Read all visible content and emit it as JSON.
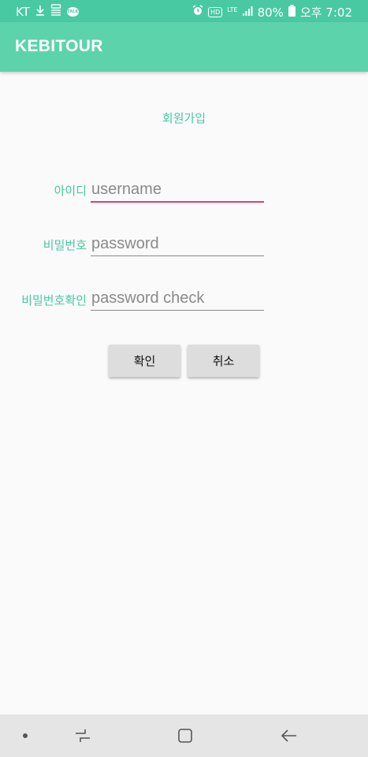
{
  "status_bar": {
    "carrier": "KT",
    "talk_badge": "TALK",
    "hd_badge": "HD",
    "network": "LTE",
    "battery": "80%",
    "time": "오후 7:02"
  },
  "app_bar": {
    "title": "KEBITOUR"
  },
  "page": {
    "heading": "회원가입"
  },
  "form": {
    "username": {
      "label": "아이디",
      "placeholder": "username"
    },
    "password": {
      "label": "비밀번호",
      "placeholder": "password"
    },
    "password_check": {
      "label": "비밀번호확인",
      "placeholder": "password check"
    }
  },
  "buttons": {
    "confirm": "확인",
    "cancel": "취소"
  },
  "colors": {
    "status_bar": "#48c9a2",
    "app_bar": "#5dd3ac",
    "accent_text": "#48c9a2",
    "focus_underline": "#e53a7b",
    "button_bg": "#dddddd",
    "nav_bar": "#e5e5e5"
  },
  "icons": {
    "status_left": [
      "download-icon",
      "notification-stack-icon",
      "kakaotalk-icon"
    ],
    "status_right": [
      "alarm-icon",
      "hd-voice-icon",
      "lte-icon",
      "signal-icon",
      "battery-icon"
    ],
    "nav": [
      "dot-icon",
      "recent-apps-icon",
      "home-icon",
      "back-icon"
    ]
  }
}
